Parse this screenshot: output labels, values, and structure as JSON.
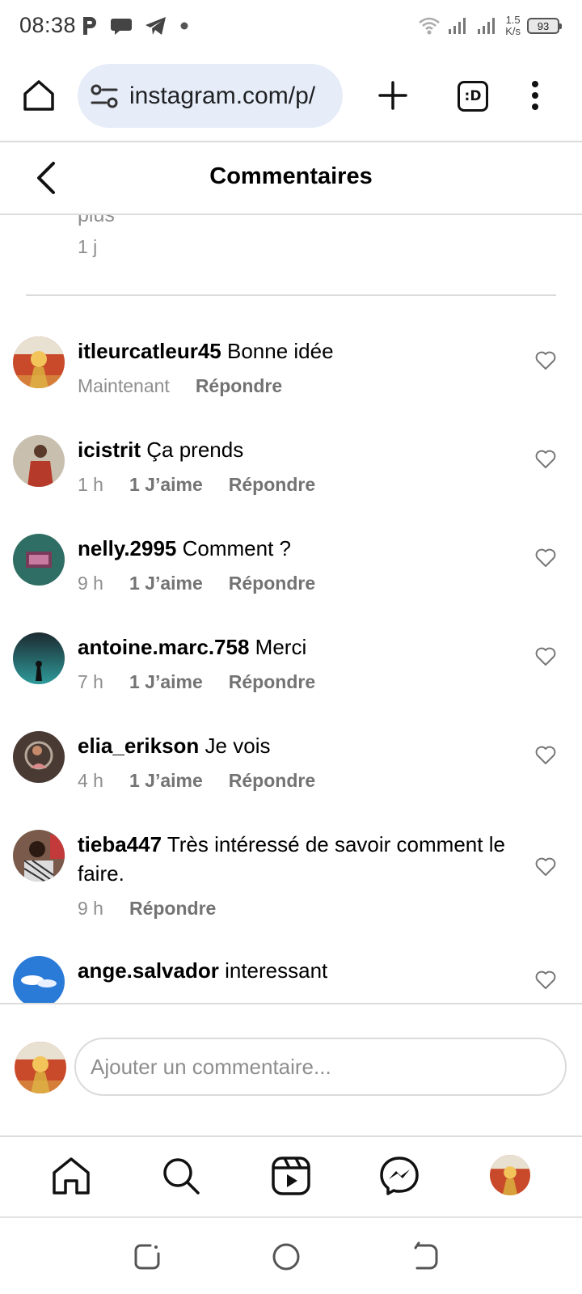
{
  "status_bar": {
    "time": "08:38",
    "network_speed_value": "1.5",
    "network_speed_unit": "K/s",
    "battery": "93",
    "icons": [
      "parking-icon",
      "chat-bubble-icon",
      "telegram-icon",
      "dot-icon",
      "wifi-icon",
      "signal-icon",
      "signal-icon",
      "battery-icon"
    ]
  },
  "browser": {
    "url": "instagram.com/p/",
    "tabs_label": ":D",
    "icons": [
      "home-icon",
      "site-settings-icon",
      "new-tab-plus-icon",
      "tab-switcher-icon",
      "more-vert-icon"
    ]
  },
  "header": {
    "title": "Commentaires"
  },
  "previous_comment": {
    "tail": "plus",
    "time": "1 j"
  },
  "comments": [
    {
      "username": "itleurcatleur45",
      "text": "Bonne idée",
      "time": "Maintenant",
      "likes": "",
      "reply": "Répondre"
    },
    {
      "username": "icistrit",
      "text": "Ça prends",
      "time": "1 h",
      "likes": "1 J’aime",
      "reply": "Répondre"
    },
    {
      "username": "nelly.2995",
      "text": "Comment ?",
      "time": "9 h",
      "likes": "1 J’aime",
      "reply": "Répondre"
    },
    {
      "username": "antoine.marc.758",
      "text": "Merci",
      "time": "7 h",
      "likes": "1 J’aime",
      "reply": "Répondre"
    },
    {
      "username": "elia_erikson",
      "text": "Je vois",
      "time": "4 h",
      "likes": "1 J’aime",
      "reply": "Répondre"
    },
    {
      "username": "tieba447",
      "text": "Très intéressé de savoir comment le faire.",
      "time": "9 h",
      "likes": "",
      "reply": "Répondre"
    },
    {
      "username": "ange.salvador",
      "text": "interessant",
      "time": "",
      "likes": "",
      "reply": ""
    }
  ],
  "composer": {
    "placeholder": "Ajouter un commentaire..."
  },
  "bottom_nav": {
    "items": [
      "home-icon",
      "search-icon",
      "reels-icon",
      "messenger-icon",
      "profile-avatar"
    ]
  },
  "system_nav": {
    "items": [
      "recents-button",
      "home-button",
      "back-button"
    ]
  },
  "colors": {
    "url_bar_bg": "#e6edf8",
    "secondary_text": "#8e8e8e",
    "divider": "#dbdbdb"
  }
}
